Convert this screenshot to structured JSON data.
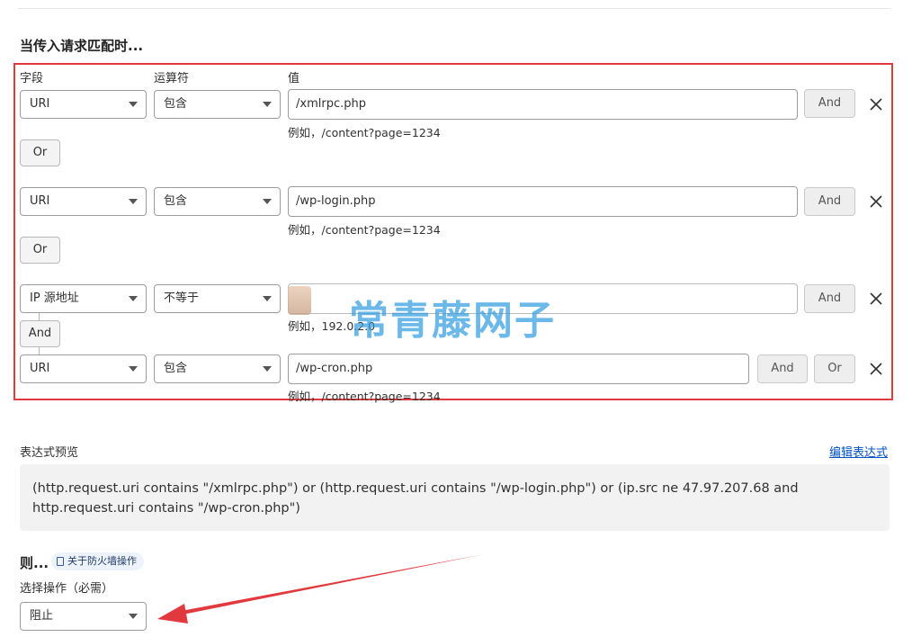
{
  "section_title": "当传入请求匹配时...",
  "columns": {
    "field": "字段",
    "operator": "运算符",
    "value": "值"
  },
  "conditions": [
    {
      "field": "URI",
      "operator": "包含",
      "value": "/xmlrpc.php",
      "hint": "例如，/content?page=1234"
    },
    {
      "field": "URI",
      "operator": "包含",
      "value": "/wp-login.php",
      "hint": "例如，/content?page=1234"
    },
    {
      "field": "IP 源地址",
      "operator": "不等于",
      "value": "",
      "hint": "例如，192.0.2.0"
    },
    {
      "field": "URI",
      "operator": "包含",
      "value": "/wp-cron.php",
      "hint": "例如，/content?page=1234"
    }
  ],
  "buttons": {
    "and": "And",
    "or": "Or"
  },
  "expression": {
    "label": "表达式预览",
    "edit_link": "编辑表达式",
    "text": "(http.request.uri contains \"/xmlrpc.php\") or (http.request.uri contains \"/wp-login.php\") or (ip.src ne 47.97.207.68 and http.request.uri contains \"/wp-cron.php\")"
  },
  "action": {
    "then_label": "则...",
    "info_badge": "关于防火墙操作",
    "select_label": "选择操作（必需）",
    "selected": "阻止"
  },
  "watermark": "常青藤网子",
  "colors": {
    "highlight_box": "#e0393e",
    "arrow": "#e0393e",
    "link": "#0051c3",
    "watermark": "#2d9be0"
  }
}
